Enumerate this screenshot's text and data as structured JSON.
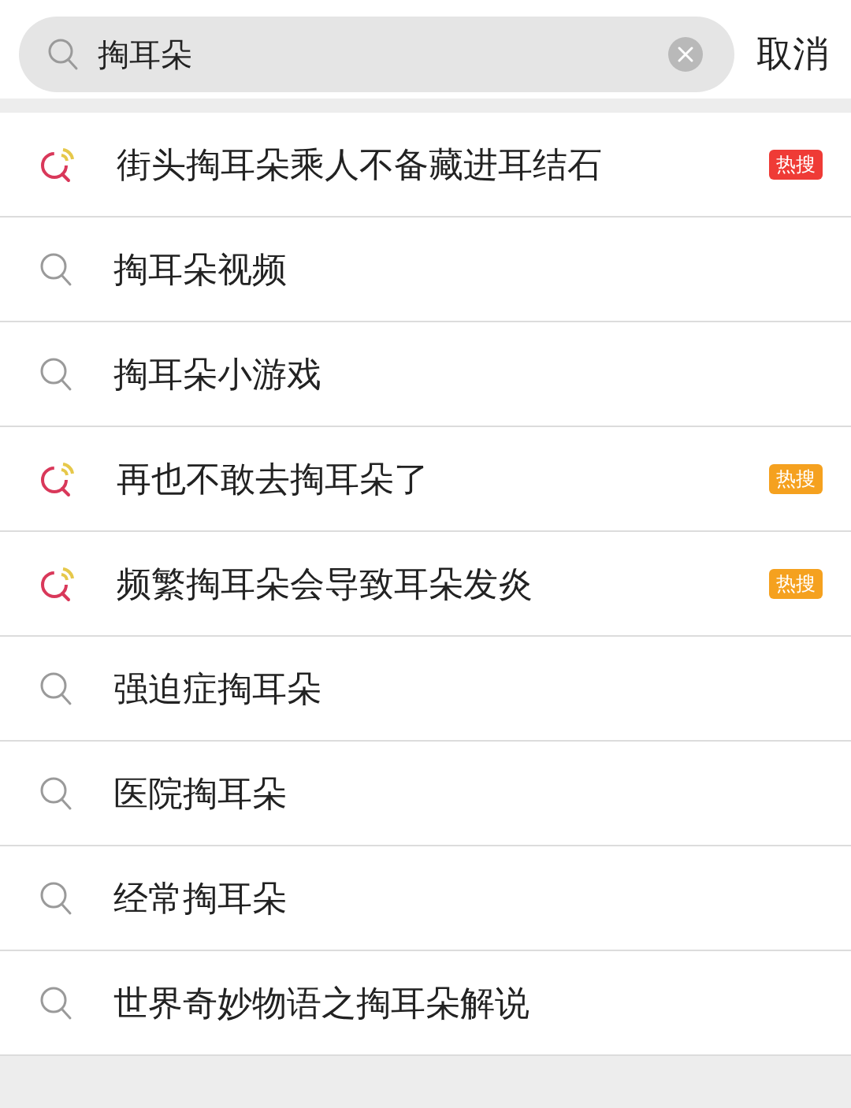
{
  "search": {
    "value": "掏耳朵",
    "cancel": "取消"
  },
  "suggestions": [
    {
      "text": "街头掏耳朵乘人不备藏进耳结石",
      "kind": "hot",
      "badge": {
        "text": "热搜",
        "color": "#ef3b36"
      }
    },
    {
      "text": "掏耳朵视频",
      "kind": "plain"
    },
    {
      "text": "掏耳朵小游戏",
      "kind": "plain"
    },
    {
      "text": "再也不敢去掏耳朵了",
      "kind": "hot",
      "badge": {
        "text": "热搜",
        "color": "#f5a11f"
      }
    },
    {
      "text": "频繁掏耳朵会导致耳朵发炎",
      "kind": "hot",
      "badge": {
        "text": "热搜",
        "color": "#f5a11f"
      }
    },
    {
      "text": "强迫症掏耳朵",
      "kind": "plain"
    },
    {
      "text": "医院掏耳朵",
      "kind": "plain"
    },
    {
      "text": "经常掏耳朵",
      "kind": "plain"
    },
    {
      "text": "世界奇妙物语之掏耳朵解说",
      "kind": "plain"
    }
  ]
}
